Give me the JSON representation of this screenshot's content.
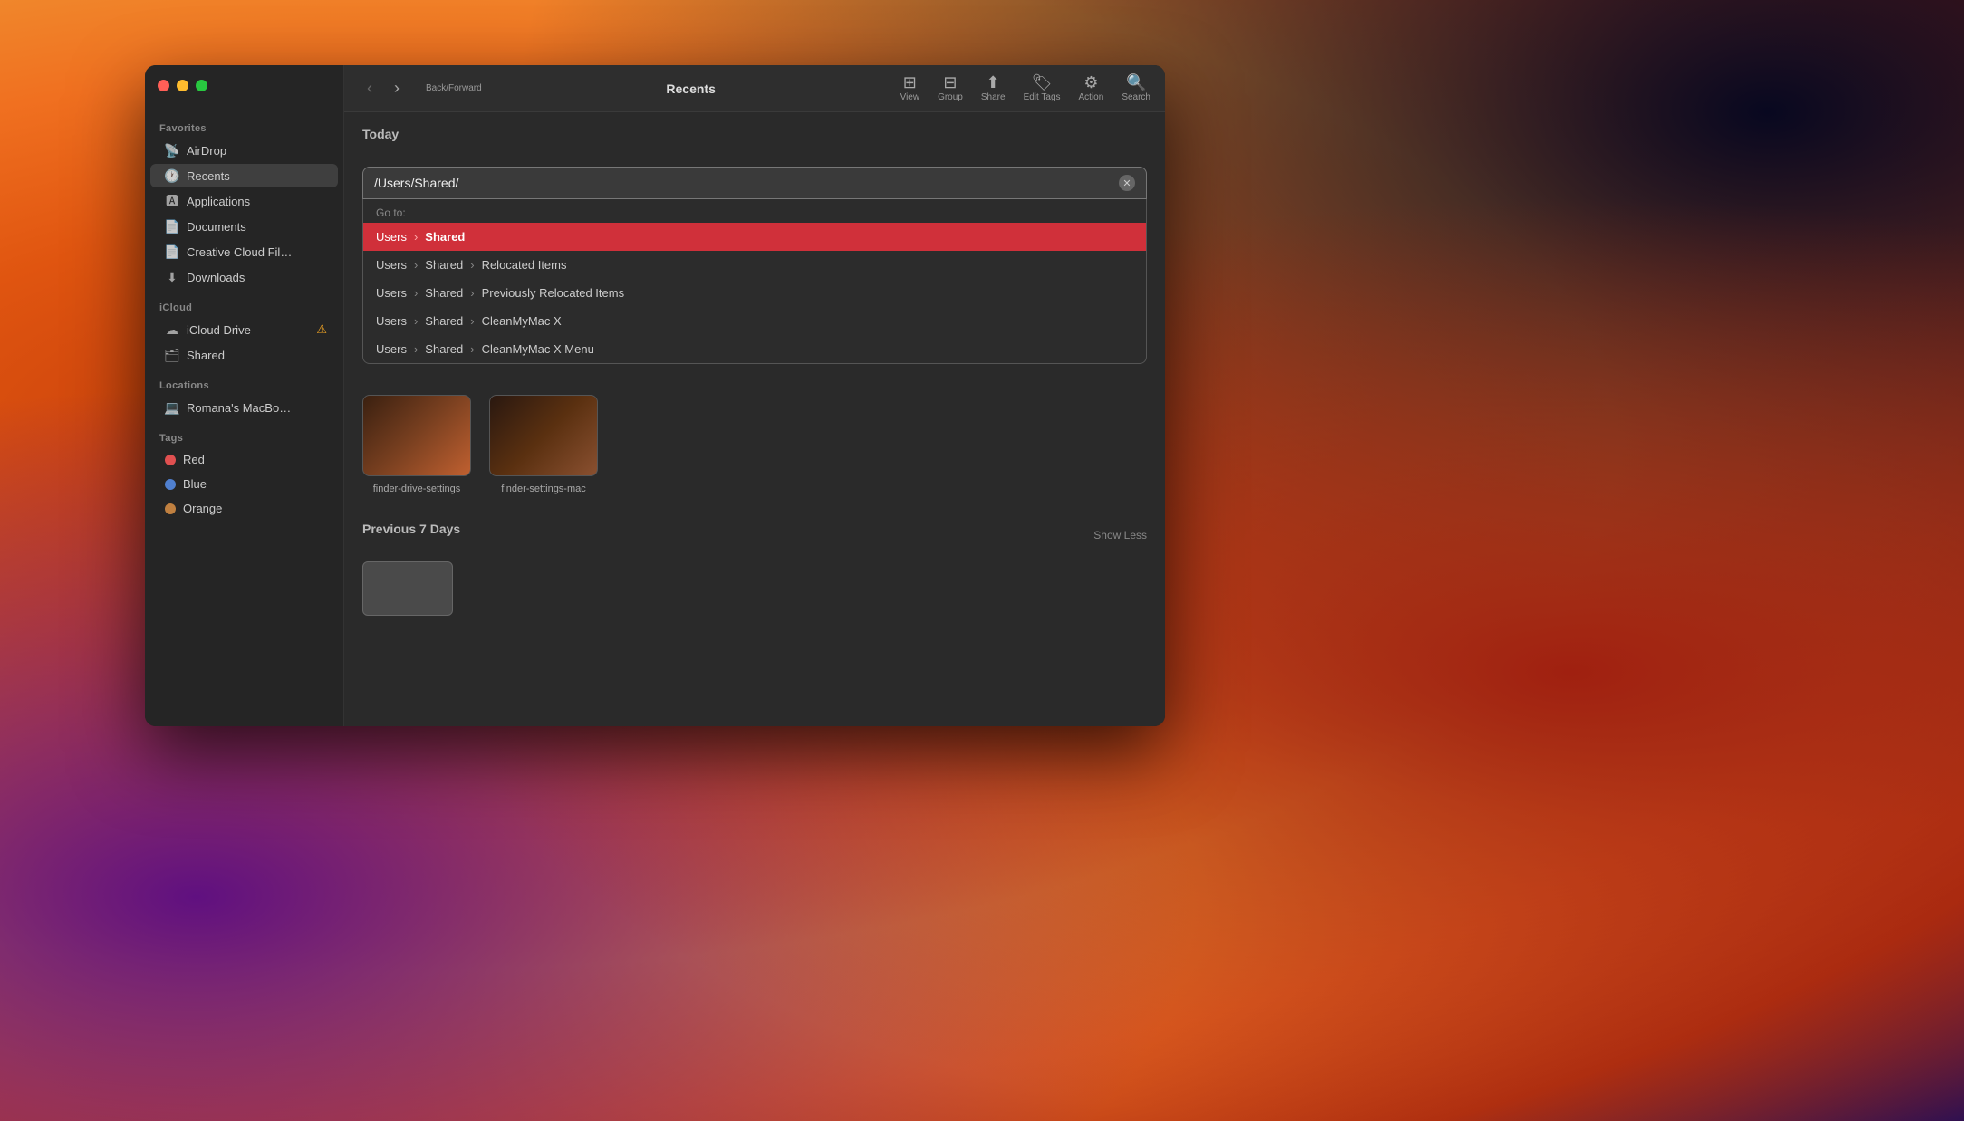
{
  "desktop": {
    "bg": "macOS Monterey gradient"
  },
  "window": {
    "title": "Recents",
    "toolbar": {
      "back_label": "Back/Forward",
      "view_label": "View",
      "group_label": "Group",
      "share_label": "Share",
      "edit_tags_label": "Edit Tags",
      "action_label": "Action",
      "search_label": "Search"
    },
    "traffic_lights": {
      "close": "close",
      "minimize": "minimize",
      "maximize": "maximize"
    }
  },
  "sidebar": {
    "favorites_label": "Favorites",
    "icloud_label": "iCloud",
    "locations_label": "Locations",
    "tags_label": "Tags",
    "items": {
      "airdrop": "AirDrop",
      "recents": "Recents",
      "applications": "Applications",
      "documents": "Documents",
      "creative_cloud": "Creative Cloud Fil…",
      "downloads": "Downloads",
      "icloud_drive": "iCloud Drive",
      "shared": "Shared",
      "macbook": "Romana's MacBo…"
    },
    "tags": {
      "red": "Red",
      "blue": "Blue",
      "orange": "Orange"
    }
  },
  "content": {
    "today_label": "Today",
    "previous_7_label": "Previous 7 Days",
    "show_less_label": "Show Less",
    "files_today": [
      {
        "name": "finder-drive-settings"
      },
      {
        "name": "finder-settings-mac"
      }
    ]
  },
  "goto_dialog": {
    "input_value": "/Users/Shared/",
    "go_to_label": "Go to:",
    "clear_icon": "✕",
    "results": [
      {
        "parts": [
          "Users",
          "Shared"
        ],
        "highlighted": true
      },
      {
        "parts": [
          "Users",
          "Shared",
          "Relocated Items"
        ],
        "highlighted": false
      },
      {
        "parts": [
          "Users",
          "Shared",
          "Previously Relocated Items"
        ],
        "highlighted": false
      },
      {
        "parts": [
          "Users",
          "Shared",
          "CleanMyMac X"
        ],
        "highlighted": false
      },
      {
        "parts": [
          "Users",
          "Shared",
          "CleanMyMac X Menu"
        ],
        "highlighted": false
      }
    ]
  }
}
